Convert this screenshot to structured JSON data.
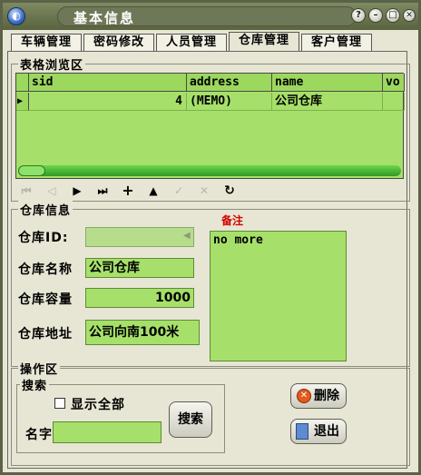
{
  "window": {
    "title": "基本信息",
    "icon": "app-globe-icon"
  },
  "title_buttons": [
    "help-icon",
    "minimize-icon",
    "maximize-icon",
    "close-icon"
  ],
  "tabs": [
    {
      "label": "车辆管理",
      "active": false
    },
    {
      "label": "密码修改",
      "active": false
    },
    {
      "label": "人员管理",
      "active": false
    },
    {
      "label": "仓库管理",
      "active": true
    },
    {
      "label": "客户管理",
      "active": false
    }
  ],
  "browse": {
    "title": "表格浏览区",
    "columns": [
      "sid",
      "address",
      "name",
      "vo"
    ],
    "rows": [
      {
        "marker": "▶",
        "sid": "4",
        "address": "(MEMO)",
        "name": "公司仓库",
        "vo": ""
      }
    ]
  },
  "navigator": {
    "buttons": [
      {
        "name": "first-record-icon",
        "glyph": "⏮",
        "enabled": false
      },
      {
        "name": "prior-record-icon",
        "glyph": "◁",
        "enabled": false
      },
      {
        "name": "next-record-icon",
        "glyph": "▶",
        "enabled": true
      },
      {
        "name": "last-record-icon",
        "glyph": "⏭",
        "enabled": true
      },
      {
        "name": "insert-record-icon",
        "glyph": "+",
        "enabled": true
      },
      {
        "name": "delete-record-icon",
        "glyph": "▲",
        "enabled": true
      },
      {
        "name": "post-edit-icon",
        "glyph": "✓",
        "enabled": false
      },
      {
        "name": "cancel-edit-icon",
        "glyph": "✕",
        "enabled": false
      },
      {
        "name": "refresh-icon",
        "glyph": "↻",
        "enabled": true
      }
    ]
  },
  "warehouse": {
    "title": "仓库信息",
    "id_label": "仓库ID:",
    "id_value": "",
    "name_label": "仓库名称",
    "name_value": "公司仓库",
    "capacity_label": "仓库容量",
    "capacity_value": "1000",
    "address_label": "仓库地址",
    "address_value": "公司向南100米",
    "memo_label": "备注",
    "memo_value": "no more"
  },
  "ops": {
    "title": "操作区",
    "search_title": "搜索",
    "show_all_label": "显示全部",
    "show_all_checked": false,
    "name_label": "名字",
    "name_value": "",
    "search_button": "搜索",
    "delete_button": "删除",
    "exit_button": "退出"
  },
  "colors": {
    "grid_bg": "#a6e06a",
    "window_bg": "#e7e6d4",
    "title_bar": "#59633f",
    "memo_label": "#d40000"
  }
}
